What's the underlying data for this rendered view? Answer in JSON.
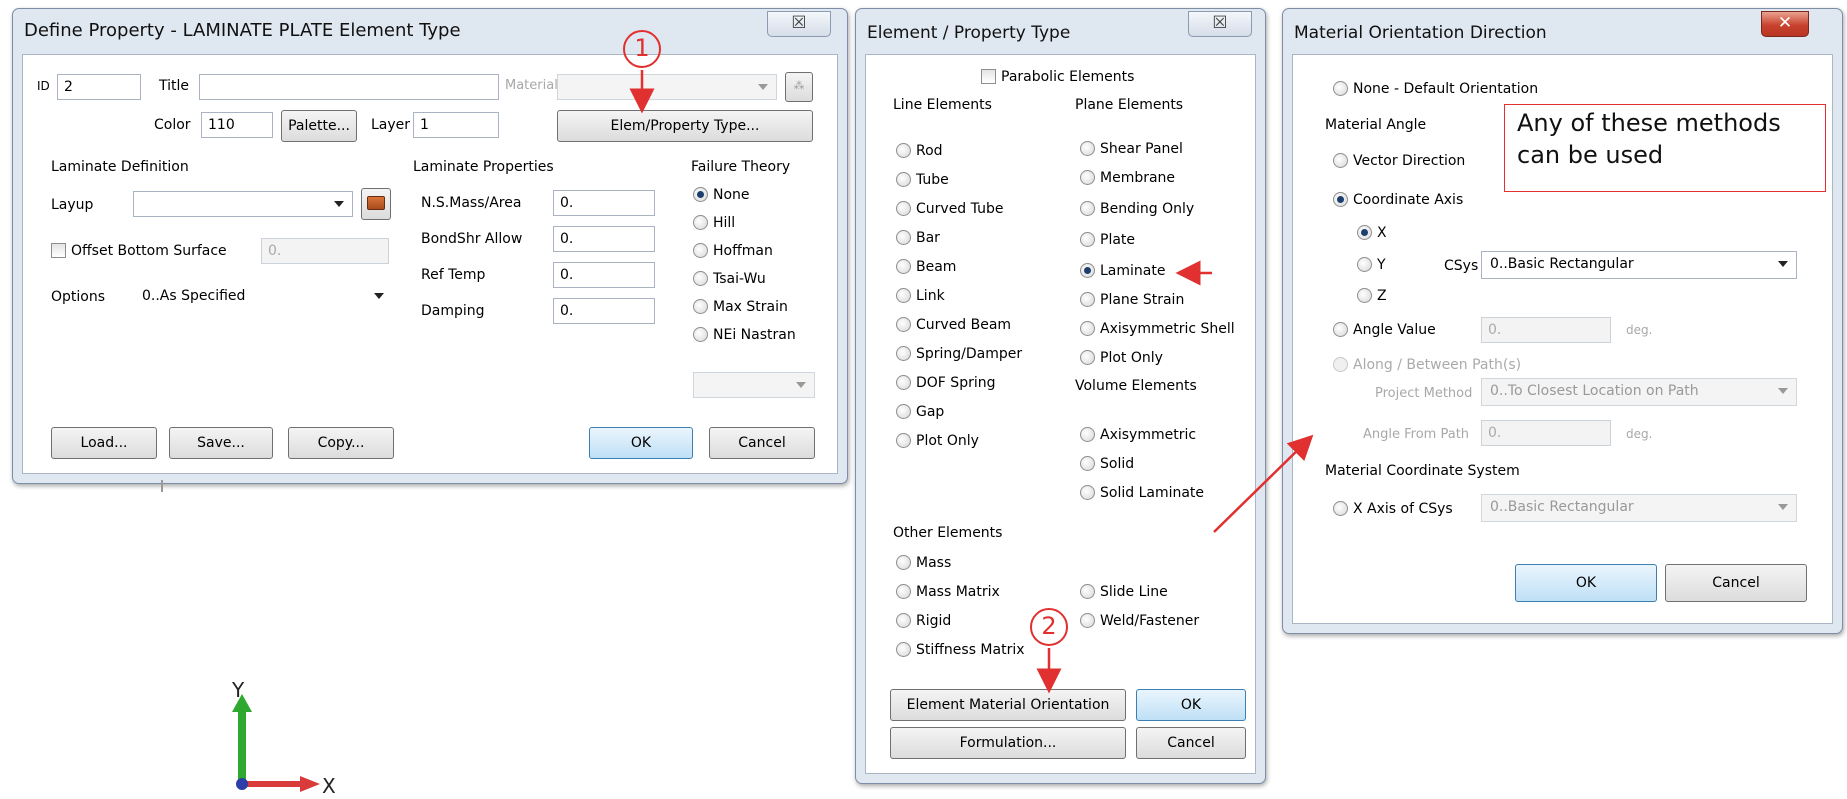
{
  "define_property": {
    "title": "Define Property - LAMINATE PLATE Element Type",
    "close": "☒",
    "id_label": "ID",
    "id_value": "2",
    "title_label": "Title",
    "title_value": "",
    "material_label": "Material",
    "material_value": "",
    "color_label": "Color",
    "color_value": "110",
    "palette_button": "Palette...",
    "layer_label": "Layer",
    "layer_value": "1",
    "elem_property_button": "Elem/Property Type...",
    "laminate_definition": "Laminate Definition",
    "layup_label": "Layup",
    "layup_value": "",
    "offset_bottom_label": "Offset Bottom Surface",
    "offset_value": "0.",
    "options_label": "Options",
    "options_value": "0..As Specified",
    "laminate_properties": "Laminate Properties",
    "props": [
      {
        "label": "N.S.Mass/Area",
        "value": "0."
      },
      {
        "label": "BondShr Allow",
        "value": "0."
      },
      {
        "label": "Ref Temp",
        "value": "0."
      },
      {
        "label": "Damping",
        "value": "0."
      }
    ],
    "failure_theory": "Failure Theory",
    "failure_options": [
      "None",
      "Hill",
      "Hoffman",
      "Tsai-Wu",
      "Max Strain",
      "NEi Nastran"
    ],
    "failure_selected": "None",
    "buttons": {
      "load": "Load...",
      "save": "Save...",
      "copy": "Copy...",
      "ok": "OK",
      "cancel": "Cancel"
    }
  },
  "element_property": {
    "title": "Element / Property Type",
    "close": "☒",
    "parabolic": "Parabolic Elements",
    "line_header": "Line Elements",
    "line_elements": [
      "Rod",
      "Tube",
      "Curved Tube",
      "Bar",
      "Beam",
      "Link",
      "Curved Beam",
      "Spring/Damper",
      "DOF Spring",
      "Gap",
      "Plot Only"
    ],
    "plane_header": "Plane Elements",
    "plane_elements": [
      "Shear Panel",
      "Membrane",
      "Bending Only",
      "Plate",
      "Laminate",
      "Plane Strain",
      "Axisymmetric Shell",
      "Plot Only"
    ],
    "plane_selected": "Laminate",
    "volume_header": "Volume Elements",
    "volume_elements": [
      "Axisymmetric",
      "Solid",
      "Solid Laminate"
    ],
    "other_header": "Other Elements",
    "other_elements": [
      "Mass",
      "Mass Matrix",
      "Rigid",
      "Stiffness Matrix"
    ],
    "other_elements_right": [
      "Slide Line",
      "Weld/Fastener"
    ],
    "buttons": {
      "orientation": "Element Material Orientation",
      "ok": "OK",
      "formulation": "Formulation...",
      "cancel": "Cancel"
    }
  },
  "material_orientation": {
    "title": "Material Orientation Direction",
    "close": "✕",
    "none_default": "None - Default Orientation",
    "material_angle": "Material Angle",
    "vector_direction": "Vector Direction",
    "coordinate_axis": "Coordinate Axis",
    "axes": [
      "X",
      "Y",
      "Z"
    ],
    "axis_selected": "X",
    "csys_label": "CSys",
    "csys_value": "0..Basic Rectangular",
    "angle_value_label": "Angle Value",
    "angle_value": "0.",
    "deg": "deg.",
    "along_between": "Along / Between Path(s)",
    "project_method_label": "Project Method",
    "project_method_value": "0..To Closest Location on Path",
    "angle_from_path_label": "Angle From Path",
    "angle_from_path_value": "0.",
    "material_csys": "Material Coordinate System",
    "x_axis_csys": "X Axis of CSys",
    "x_axis_csys_value": "0..Basic Rectangular",
    "buttons": {
      "ok": "OK",
      "cancel": "Cancel"
    }
  },
  "annotations": {
    "callout": "Any of these methods can be used",
    "step1": "1",
    "step2": "2",
    "color": "#e03030"
  },
  "triad": {
    "y_label": "Y",
    "x_label": "X"
  }
}
